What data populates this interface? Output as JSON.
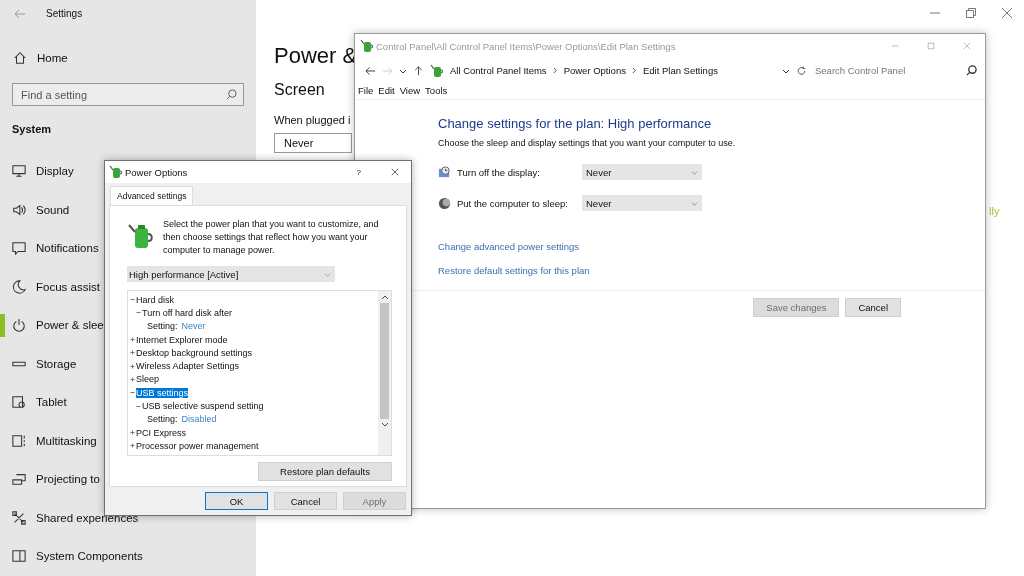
{
  "settings_window": {
    "title": "Settings",
    "sidebar": {
      "home": "Home",
      "search": {
        "placeholder": "Find a setting"
      },
      "section": "System",
      "items": [
        {
          "label": "Display",
          "selected": false
        },
        {
          "label": "Sound",
          "selected": false
        },
        {
          "label": "Notifications",
          "selected": false
        },
        {
          "label": "Focus assist",
          "selected": false
        },
        {
          "label": "Power & slee",
          "selected": true
        },
        {
          "label": "Storage",
          "selected": false
        },
        {
          "label": "Tablet",
          "selected": false
        },
        {
          "label": "Multitasking",
          "selected": false
        },
        {
          "label": "Projecting to",
          "selected": false
        },
        {
          "label": "Shared experiences",
          "selected": false
        },
        {
          "label": "System Components",
          "selected": false
        }
      ]
    },
    "main": {
      "heading": "Power &",
      "subheading": "Screen",
      "field_label": "When plugged i",
      "dropdown_value": "Never",
      "partial_link": "lly"
    }
  },
  "control_panel_window": {
    "title": "Control Panel\\All Control Panel Items\\Power Options\\Edit Plan Settings",
    "forward_button": {
      "disabled": true
    },
    "breadcrumbs": [
      "All Control Panel Items",
      "Power Options",
      "Edit Plan Settings"
    ],
    "search": {
      "placeholder": "Search Control Panel"
    },
    "menu": [
      "File",
      "Edit",
      "View",
      "Tools"
    ],
    "heading": "Change settings for the plan: High performance",
    "description": "Choose the sleep and display settings that you want your computer to use.",
    "settings": [
      {
        "kind": "display",
        "label": "Turn off the display:",
        "value": "Never"
      },
      {
        "kind": "sleep",
        "label": "Put the computer to sleep:",
        "value": "Never"
      }
    ],
    "links": [
      "Change advanced power settings",
      "Restore default settings for this plan"
    ],
    "buttons": [
      {
        "label": "Save changes",
        "disabled": true
      },
      {
        "label": "Cancel",
        "disabled": false
      }
    ]
  },
  "power_options_dialog": {
    "title": "Power Options",
    "help": "?",
    "tabs": [
      {
        "label": "Advanced settings",
        "selected": true
      }
    ],
    "description": "Select the power plan that you want to customize, and then choose settings that reflect how you want your computer to manage power.",
    "plan": "High performance [Active]",
    "tree": [
      {
        "kind": "group",
        "label": "Hard disk",
        "expanded": true,
        "selected": false,
        "children": [
          {
            "kind": "group",
            "label": "Turn off hard disk after",
            "expanded": true,
            "selected": false,
            "children": [
              {
                "kind": "setting",
                "label": "Setting:",
                "value": "Never",
                "selected": false
              }
            ]
          }
        ]
      },
      {
        "kind": "group",
        "label": "Internet Explorer mode",
        "expanded": false,
        "selected": false
      },
      {
        "kind": "group",
        "label": "Desktop background settings",
        "expanded": false,
        "selected": false
      },
      {
        "kind": "group",
        "label": "Wireless Adapter Settings",
        "expanded": false,
        "selected": false
      },
      {
        "kind": "group",
        "label": "Sleep",
        "expanded": false,
        "selected": false
      },
      {
        "kind": "group",
        "label": "USB settings",
        "expanded": true,
        "selected": true,
        "children": [
          {
            "kind": "group",
            "label": "USB selective suspend setting",
            "expanded": true,
            "selected": false,
            "children": [
              {
                "kind": "setting",
                "label": "Setting:",
                "value": "Disabled",
                "selected": false
              }
            ]
          }
        ]
      },
      {
        "kind": "group",
        "label": "PCI Express",
        "expanded": false,
        "selected": false
      },
      {
        "kind": "group",
        "label": "Processor power management",
        "expanded": false,
        "selected": false
      }
    ],
    "restore_button": "Restore plan defaults",
    "buttons": [
      {
        "label": "OK",
        "default": true,
        "disabled": false
      },
      {
        "label": "Cancel",
        "default": false,
        "disabled": false
      },
      {
        "label": "Apply",
        "default": false,
        "disabled": true
      }
    ]
  }
}
